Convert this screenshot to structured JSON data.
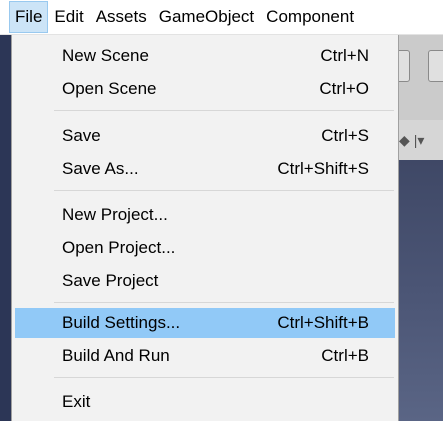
{
  "menubar": {
    "items": [
      "File",
      "Edit",
      "Assets",
      "GameObject",
      "Component"
    ],
    "active": "File"
  },
  "file_menu": {
    "items": [
      {
        "label": "New Scene",
        "shortcut": "Ctrl+N"
      },
      {
        "label": "Open Scene",
        "shortcut": "Ctrl+O"
      },
      {
        "label": "Save",
        "shortcut": "Ctrl+S"
      },
      {
        "label": "Save As...",
        "shortcut": "Ctrl+Shift+S"
      },
      {
        "label": "New Project...",
        "shortcut": ""
      },
      {
        "label": "Open Project...",
        "shortcut": ""
      },
      {
        "label": "Save Project",
        "shortcut": ""
      },
      {
        "label": "Build Settings...",
        "shortcut": "Ctrl+Shift+B",
        "highlighted": true
      },
      {
        "label": "Build And Run",
        "shortcut": "Ctrl+B"
      },
      {
        "label": "Exit",
        "shortcut": ""
      }
    ]
  },
  "colors": {
    "highlight": "#91c9f7",
    "menu_background": "#f2f2f2",
    "menubar_active": "#cce4f7",
    "scene_view": "#4b5575"
  }
}
